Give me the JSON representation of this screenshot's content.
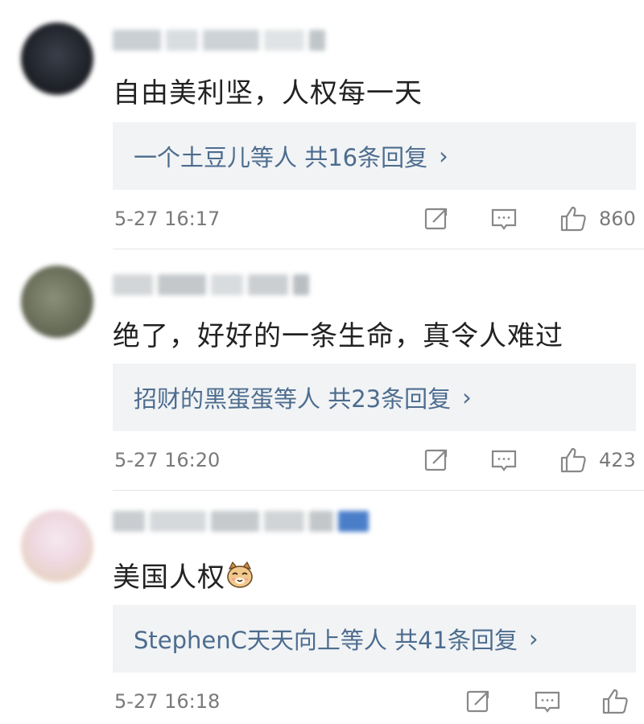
{
  "comments": [
    {
      "text": "自由美利坚，人权每一天",
      "reply_summary": "一个土豆儿等人 共16条回复",
      "timestamp": "5-27 16:17",
      "likes": "860"
    },
    {
      "text": "绝了，好好的一条生命，真令人难过",
      "reply_summary": "招财的黑蛋蛋等人 共23条回复",
      "timestamp": "5-27 16:20",
      "likes": "423"
    },
    {
      "text": "美国人权",
      "reply_summary": "StephenC天天向上等人 共41条回复",
      "timestamp": "5-27 16:18",
      "likes": ""
    }
  ],
  "reply_arrow": "›",
  "icons": {
    "share": "share-icon",
    "comment": "comment-icon",
    "like": "thumbs-up-icon",
    "emoji": "cat-face-emoji"
  },
  "colors": {
    "reply_text": "#4d6c8e",
    "reply_bg": "#f1f3f5",
    "meta": "#7a7a7a"
  }
}
